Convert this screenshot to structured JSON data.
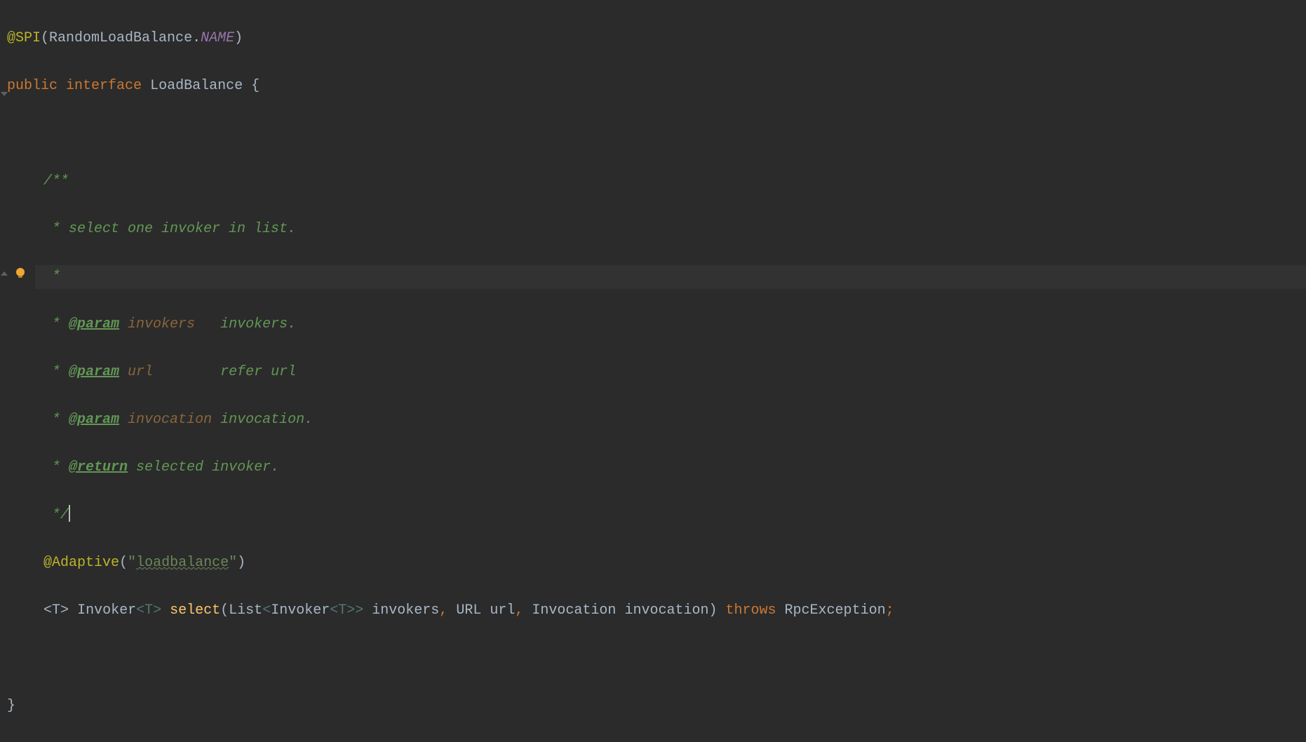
{
  "code": {
    "annotation_spi": "@SPI",
    "spi_arg_class": "RandomLoadBalance",
    "spi_arg_dot": ".",
    "spi_arg_name": "NAME",
    "public": "public",
    "interface": "interface",
    "interface_name": "LoadBalance",
    "doc_start": "/**",
    "doc_desc": " * select one invoker in list.",
    "doc_empty": " *",
    "doc_param_tag": "@param",
    "doc_param1_name": "invokers",
    "doc_param1_desc": "invokers.",
    "doc_param2_name": "url",
    "doc_param2_desc": "refer url",
    "doc_param3_name": "invocation",
    "doc_param3_desc": "invocation.",
    "doc_return_tag": "@return",
    "doc_return_desc": "selected invoker.",
    "doc_end_partial": " */",
    "annotation_adaptive": "@Adaptive",
    "adaptive_arg": "loadbalance",
    "generic_T": "T",
    "type_invoker": "Invoker",
    "method_name": "select",
    "type_list": "List",
    "param1": "invokers",
    "type_url": "URL",
    "param2": "url",
    "type_invocation": "Invocation",
    "param3": "invocation",
    "throws": "throws",
    "exception": "RpcException",
    "brace_open": "{",
    "brace_close": "}"
  }
}
